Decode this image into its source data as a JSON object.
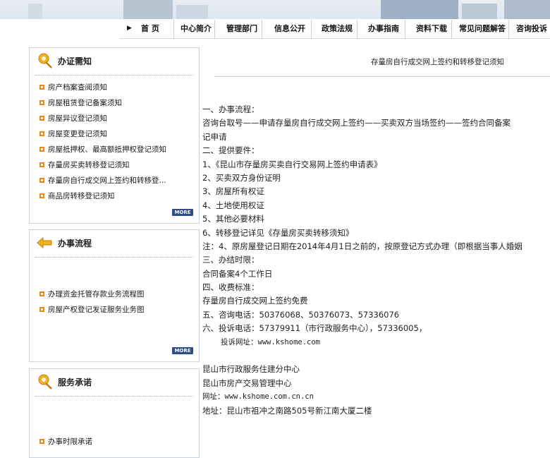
{
  "nav": {
    "items": [
      "首 页",
      "中心简介",
      "管理部门",
      "信息公开",
      "政策法规",
      "办事指南",
      "资料下载",
      "常见问题解答",
      "咨询投诉"
    ]
  },
  "panels": [
    {
      "title": "办证需知",
      "icon": "pin-icon",
      "items": [
        "房产档案查阅须知",
        "房屋租赁登记备案须知",
        "房屋异议登记须知",
        "房屋变更登记须知",
        "房屋抵押权、最高额抵押权登记须知",
        "存量房买卖转移登记须知",
        "存量房自行成交网上签约和转移登...",
        "商品房转移登记须知"
      ],
      "more": "MORE"
    },
    {
      "title": "办事流程",
      "icon": "arrow-icon",
      "items": [
        "办理资金托管存款业务流程图",
        "房屋产权登记发证服务业务图"
      ],
      "more": "MORE"
    },
    {
      "title": "服务承诺",
      "icon": "pin-icon",
      "items": [
        "办事时限承诺"
      ]
    }
  ],
  "article": {
    "title": "存量房自行成交网上签约和转移登记须知",
    "lines": [
      "一、办事流程：",
      "咨询台取号——申请存量房自行成交网上签约——买卖双方当场签约——签约合同备案",
      "记申请",
      "二、提供要件：",
      "1、《昆山市存量房买卖自行交易网上签约申请表》",
      "2、买卖双方身份证明",
      "3、房屋所有权证",
      "4、土地使用权证",
      "5、其他必要材料",
      "6、转移登记详见《存量房买卖转移须知》",
      "注：4、原房屋登记日期在2014年4月1日之前的，按原登记方式办理（即根据当事人婚姻",
      "三、办结时限：",
      "合同备案4个工作日",
      "四、收费标准：",
      "存量房自行成交网上签约免费",
      "五、咨询电话：50376068、50376073、57336076",
      "六、投诉电话：57379911（市行政服务中心），57336005，",
      "投诉网址：www.kshome.com",
      "",
      "昆山市行政服务住建分中心",
      "昆山市房产交易管理中心",
      "网址：www.kshome.com.cn.cn",
      "地址：昆山市祖冲之南路505号新江南大厦二楼"
    ]
  },
  "colors": {
    "more_bg": "#2e4d86",
    "bullet": "#e38a1c",
    "border": "#c9d3dd"
  }
}
